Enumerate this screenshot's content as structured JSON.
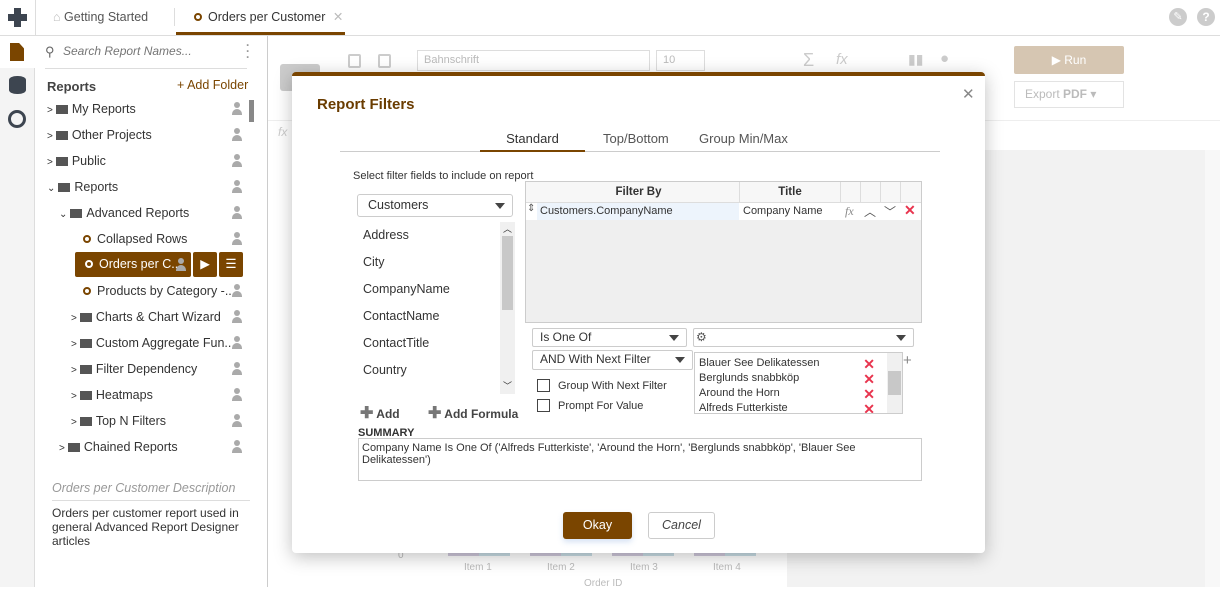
{
  "app": {
    "colors": {
      "brand": "#7a4500",
      "danger": "#e8344e"
    }
  },
  "tabs": [
    {
      "label": "Getting Started",
      "icon": "home-icon"
    },
    {
      "label": "Orders per Customer",
      "icon": "report-circle-icon",
      "active": true
    }
  ],
  "sidebar": {
    "search_placeholder": "Search Report Names...",
    "header": "Reports",
    "add_folder": "+ Add Folder",
    "items": [
      {
        "label": "My Reports",
        "type": "folder",
        "level": 0,
        "expanded": false
      },
      {
        "label": "Other Projects",
        "type": "folder",
        "level": 0,
        "expanded": false
      },
      {
        "label": "Public",
        "type": "folder",
        "level": 0,
        "expanded": false
      },
      {
        "label": "Reports",
        "type": "folder",
        "level": 0,
        "expanded": true
      },
      {
        "label": "Advanced Reports",
        "type": "folder",
        "level": 1,
        "expanded": true
      },
      {
        "label": "Collapsed Rows",
        "type": "report",
        "level": 2
      },
      {
        "label": "Orders per C...",
        "type": "report",
        "level": 2,
        "selected": true
      },
      {
        "label": "Products by Category -...",
        "type": "report",
        "level": 2
      },
      {
        "label": "Charts & Chart Wizard",
        "type": "folder",
        "level": 2
      },
      {
        "label": "Custom Aggregate Fun...",
        "type": "folder",
        "level": 2
      },
      {
        "label": "Filter Dependency",
        "type": "folder",
        "level": 2
      },
      {
        "label": "Heatmaps",
        "type": "folder",
        "level": 2
      },
      {
        "label": "Top N Filters",
        "type": "folder",
        "level": 2
      },
      {
        "label": "Chained Reports",
        "type": "folder",
        "level": 1
      }
    ],
    "description_title": "Orders per Customer Description",
    "description": "Orders per customer report used in general Advanced Report Designer articles"
  },
  "toolbar": {
    "font": "Bahnschrift",
    "font_size": "10",
    "run": "Run",
    "export_prefix": "Export ",
    "export_format": "PDF"
  },
  "background": {
    "chart_ticks": [
      "Item 1",
      "Item 2",
      "Item 3",
      "Item 4"
    ],
    "chart_zero": "0",
    "chart_xlabel": "Order ID"
  },
  "modal": {
    "title": "Report Filters",
    "tabs": [
      "Standard",
      "Top/Bottom",
      "Group Min/Max"
    ],
    "instruction": "Select filter fields to include on report",
    "table_select": "Customers",
    "fields": [
      "Address",
      "City",
      "CompanyName",
      "ContactName",
      "ContactTitle",
      "Country"
    ],
    "add": "Add",
    "add_formula": "Add Formula",
    "grid": {
      "headers": [
        "Filter By",
        "Title"
      ],
      "rows": [
        {
          "filter_by": "Customers.CompanyName",
          "title": "Company Name"
        }
      ]
    },
    "operator": "Is One Of",
    "value_select": "",
    "logic": "AND With Next Filter",
    "group_with_next": "Group With Next Filter",
    "prompt_for_value": "Prompt For Value",
    "values": [
      "Blauer See Delikatessen",
      "Berglunds snabbköp",
      "Around the Horn",
      "Alfreds Futterkiste"
    ],
    "summary_label": "SUMMARY",
    "summary": "Company Name Is One Of ('Alfreds Futterkiste', 'Around the Horn', 'Berglunds snabbköp', 'Blauer See Delikatessen')",
    "okay": "Okay",
    "cancel": "Cancel"
  }
}
